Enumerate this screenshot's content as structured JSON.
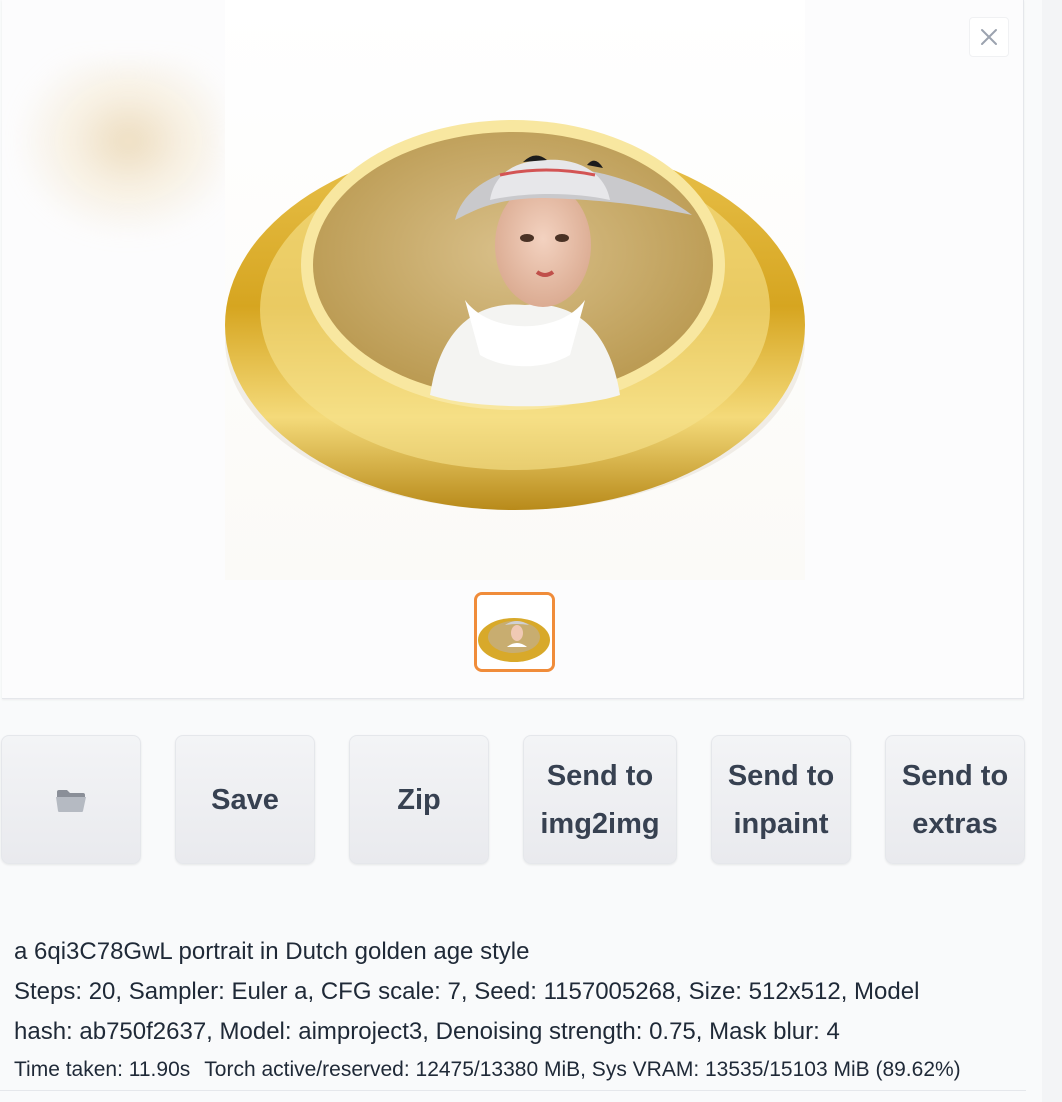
{
  "gallery": {
    "close_label": "×",
    "main_image_alt": "Generated portrait on gold plate",
    "thumbnail_alt": "thumbnail",
    "accent_color": "#f08c3a"
  },
  "buttons": {
    "folder_icon": "folder-icon",
    "save_label": "Save",
    "zip_label": "Zip",
    "img2img_line1": "Send to",
    "img2img_line2": "img2img",
    "inpaint_line1": "Send to",
    "inpaint_line2": "inpaint",
    "extras_line1": "Send to",
    "extras_line2": "extras"
  },
  "info": {
    "prompt": "a 6qi3C78GwL portrait in Dutch golden age style",
    "params_line1": "Steps: 20, Sampler: Euler a, CFG scale: 7, Seed: 1157005268, Size: 512x512, Model",
    "params_line2": "hash: ab750f2637, Model: aimproject3, Denoising strength: 0.75, Mask blur: 4"
  },
  "performance": {
    "time_taken": "Time taken: 11.90s",
    "memory": "Torch active/reserved: 12475/13380 MiB, Sys VRAM: 13535/15103 MiB (89.62%)"
  }
}
